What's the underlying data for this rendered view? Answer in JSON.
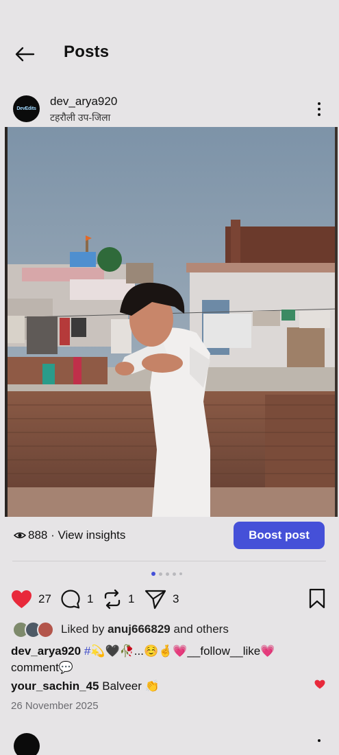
{
  "header": {
    "title": "Posts",
    "back_icon": "arrow-left-icon"
  },
  "post": {
    "avatar_text": "DevEdits",
    "username": "dev_arya920",
    "location": "टहरौली उप-जिला",
    "more_icon": "more-vertical-icon",
    "views": "888 · View insights",
    "boost_label": "Boost post",
    "carousel": {
      "count": 5,
      "active_index": 0
    },
    "actions": {
      "likes": "27",
      "comments": "1",
      "reposts": "1",
      "shares": "3"
    },
    "liked_by": {
      "prefix": "Liked by",
      "user": "anuj666829",
      "suffix": "and others"
    },
    "caption": {
      "username": "dev_arya920",
      "hashtag": "#",
      "text": "💫🖤🥀...☺️🤞💗__follow__like💗 comment💬"
    },
    "top_comment": {
      "username": "your_sachin_45",
      "text": "Balveer 👏"
    },
    "date": "26 November 2025"
  },
  "colors": {
    "accent": "#4550d8",
    "like_red": "#e8293b",
    "background": "#e6e4e6"
  }
}
